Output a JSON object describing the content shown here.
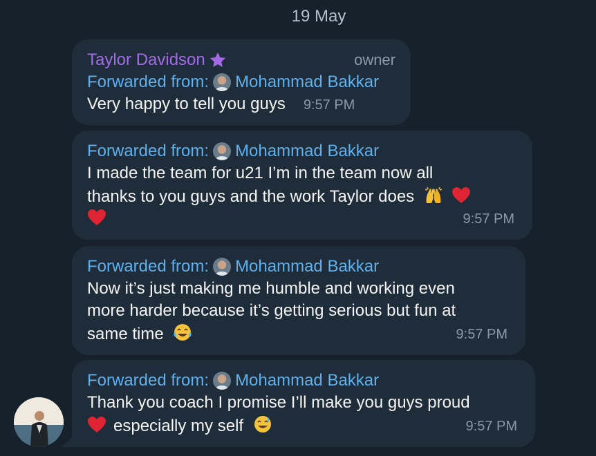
{
  "date_label": "19 May",
  "messages": [
    {
      "sender": "Taylor Davidson",
      "role": "owner",
      "forward_label": "Forwarded from:",
      "forward_name": "Mohammad Bakkar",
      "text": "Very happy to tell you guys",
      "time": "9:57 PM"
    },
    {
      "forward_label": "Forwarded from:",
      "forward_name": "Mohammad Bakkar",
      "line1": "I made the team for u21 I’m in the team now all",
      "line2": "thanks to you guys and the work Taylor does",
      "time": "9:57 PM"
    },
    {
      "forward_label": "Forwarded from:",
      "forward_name": "Mohammad Bakkar",
      "line1": "Now it’s just making me humble and working even",
      "line2": "more harder because it’s getting serious but fun at",
      "line3": "same time",
      "time": "9:57 PM"
    },
    {
      "forward_label": "Forwarded from:",
      "forward_name": "Mohammad Bakkar",
      "line1": "Thank you coach I promise I’ll make you guys proud",
      "line2": "especially my self",
      "time": "9:57 PM"
    }
  ],
  "colors": {
    "background": "#17212b",
    "bubble": "#1f2d3a",
    "sender_name": "#a26ae7",
    "forward_link": "#5eb0ef",
    "meta_text": "#8a9aa9"
  },
  "icons": {
    "admin_star": "star-icon",
    "heart": "red-heart-emoji",
    "raised_hands": "raising-hands-emoji",
    "laughing": "tears-of-joy-emoji",
    "sweat_smile": "grinning-sweat-emoji"
  }
}
